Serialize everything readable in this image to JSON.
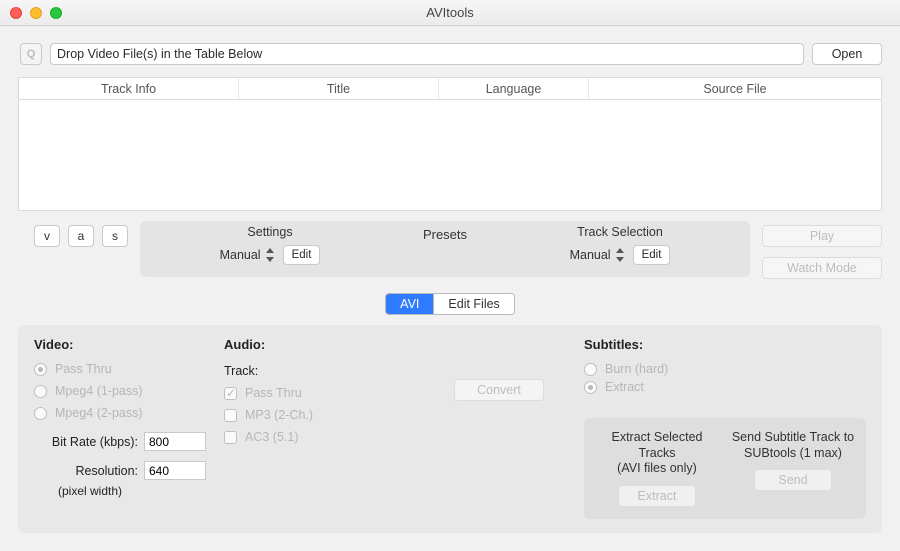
{
  "window": {
    "title": "AVItools"
  },
  "topbar": {
    "qbox": "Q",
    "path_value": "Drop Video File(s) in the Table Below",
    "open_label": "Open"
  },
  "table": {
    "columns": [
      "Track Info",
      "Title",
      "Language",
      "Source File"
    ]
  },
  "vas": {
    "v": "v",
    "a": "a",
    "s": "s"
  },
  "presets": {
    "title": "Presets",
    "settings_label": "Settings",
    "settings_value": "Manual",
    "track_label": "Track Selection",
    "track_value": "Manual",
    "edit_label": "Edit"
  },
  "sidebuttons": {
    "play": "Play",
    "watch": "Watch Mode"
  },
  "segmented": {
    "avi": "AVI",
    "edit_files": "Edit Files"
  },
  "video": {
    "heading": "Video:",
    "pass": "Pass Thru",
    "m1": "Mpeg4 (1-pass)",
    "m2": "Mpeg4 (2-pass)",
    "bitrate_label": "Bit Rate (kbps):",
    "bitrate_value": "800",
    "res_label": "Resolution:",
    "res_value": "640",
    "res_hint": "(pixel width)"
  },
  "audio": {
    "heading": "Audio:",
    "track_label": "Track:",
    "pass": "Pass Thru",
    "mp3": "MP3 (2-Ch.)",
    "ac3": "AC3 (5.1)"
  },
  "convert_label": "Convert",
  "subtitles": {
    "heading": "Subtitles:",
    "burn": "Burn (hard)",
    "extract": "Extract",
    "extract_box_label": "Extract Selected Tracks\n(AVI files only)",
    "extract_btn": "Extract",
    "send_box_label": "Send Subtitle Track to\nSUBtools (1 max)",
    "send_btn": "Send"
  }
}
